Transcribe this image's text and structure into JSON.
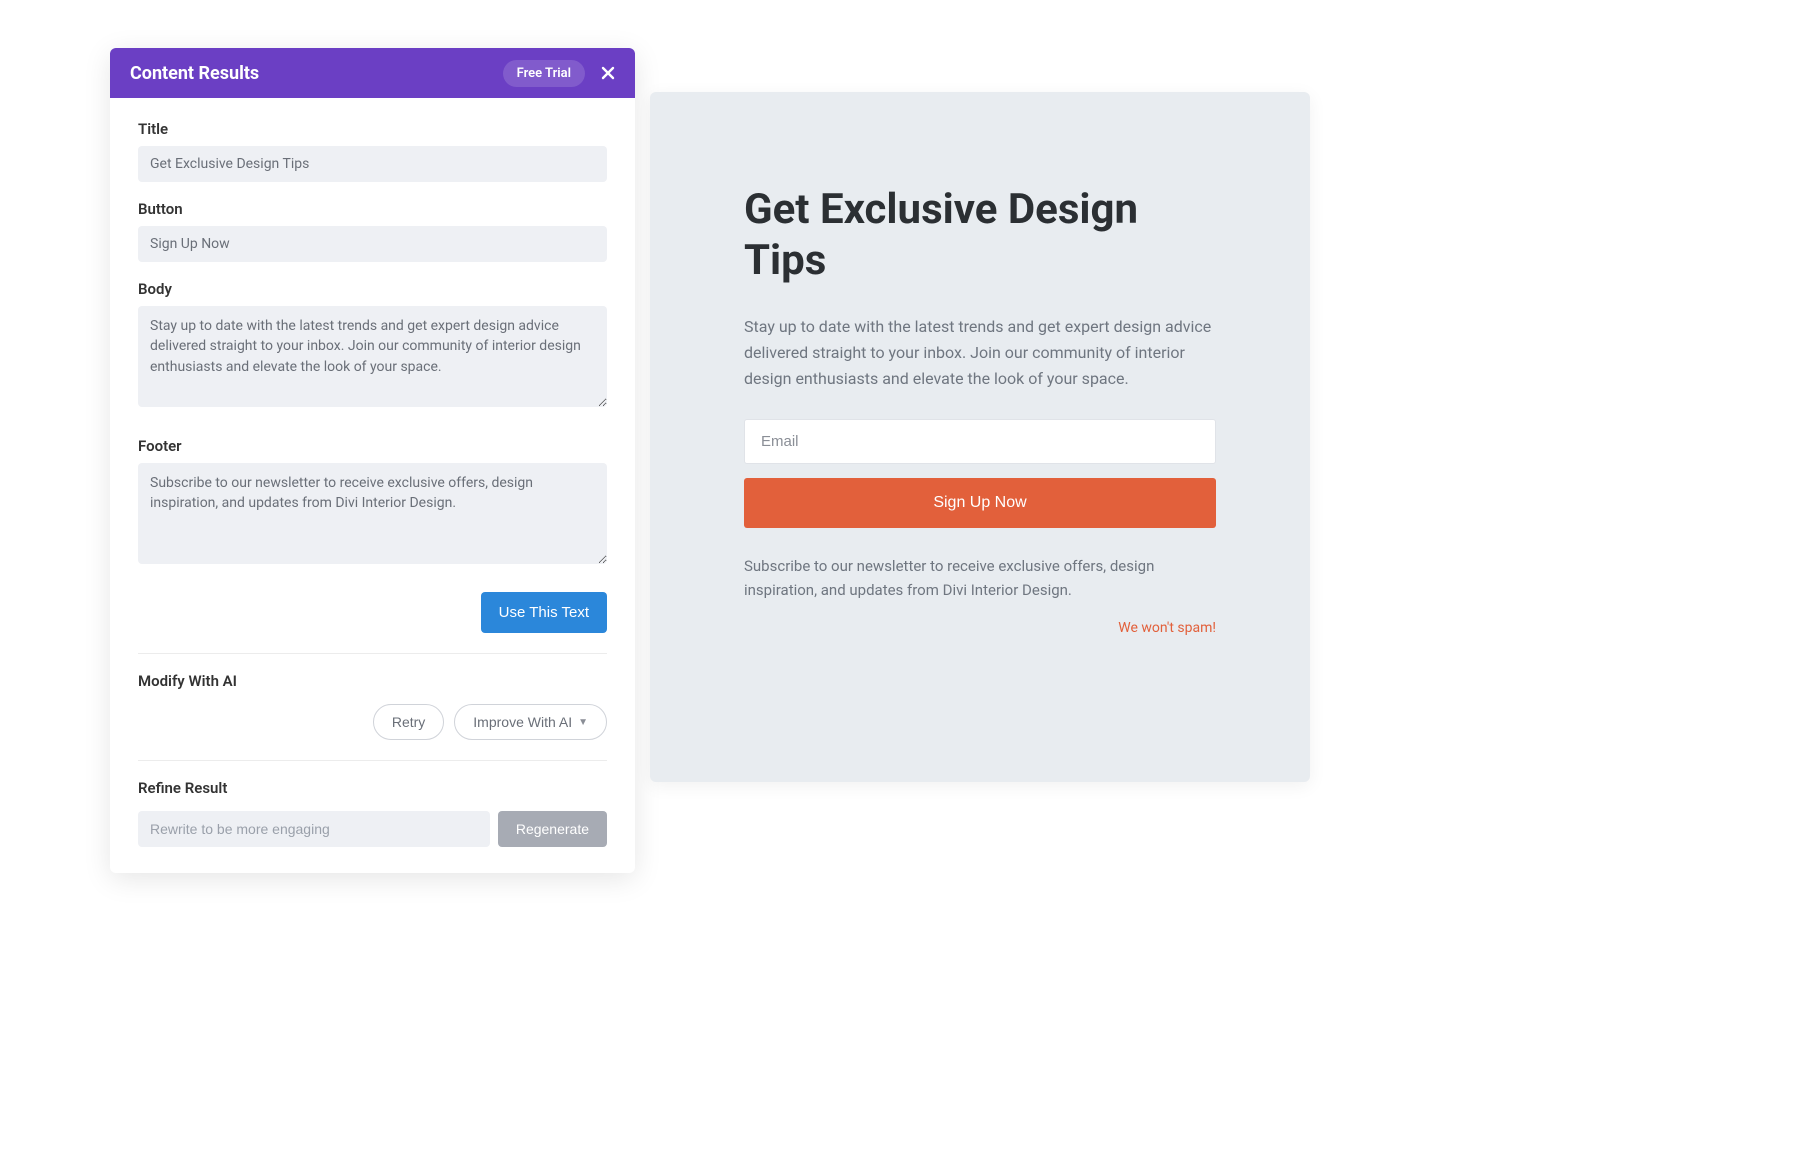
{
  "panel": {
    "header_title": "Content Results",
    "free_trial_label": "Free Trial",
    "fields": {
      "title_label": "Title",
      "title_value": "Get Exclusive Design Tips",
      "button_label": "Button",
      "button_value": "Sign Up Now",
      "body_label": "Body",
      "body_value": "Stay up to date with the latest trends and get expert design advice delivered straight to your inbox. Join our community of interior design enthusiasts and elevate the look of your space.",
      "footer_label": "Footer",
      "footer_value": "Subscribe to our newsletter to receive exclusive offers, design inspiration, and updates from Divi Interior Design."
    },
    "use_this_text_label": "Use This Text",
    "modify_label": "Modify With AI",
    "retry_label": "Retry",
    "improve_label": "Improve With AI",
    "refine_label": "Refine Result",
    "refine_placeholder": "Rewrite to be more engaging",
    "regenerate_label": "Regenerate"
  },
  "preview": {
    "title": "Get Exclusive Design Tips",
    "body": "Stay up to date with the latest trends and get expert design advice delivered straight to your inbox. Join our community of interior design enthusiasts and elevate the look of your space.",
    "email_placeholder": "Email",
    "button_label": "Sign Up Now",
    "footer": "Subscribe to our newsletter to receive exclusive offers, design inspiration, and updates from Divi Interior Design.",
    "spam_text": "We won't spam!"
  },
  "colors": {
    "brand_purple": "#6b3fc4",
    "primary_blue": "#2b87da",
    "accent_orange": "#e2603b",
    "muted_gray": "#a7abb4"
  }
}
